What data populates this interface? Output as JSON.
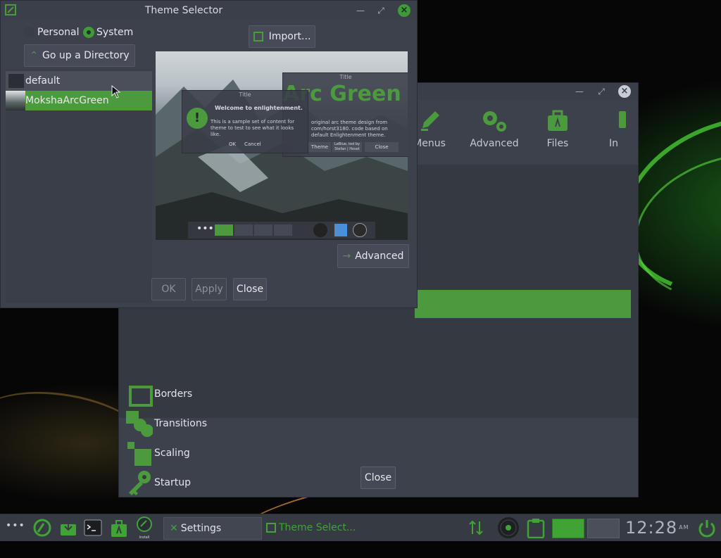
{
  "settings_window": {
    "icons": [
      {
        "label": "Menus"
      },
      {
        "label": "Advanced"
      },
      {
        "label": "Files"
      },
      {
        "label": "In"
      }
    ],
    "list": [
      {
        "label": "Borders"
      },
      {
        "label": "Transitions"
      },
      {
        "label": "Scaling"
      },
      {
        "label": "Startup"
      }
    ],
    "close_label": "Close"
  },
  "theme_window": {
    "title": "Theme Selector",
    "personal_label": "Personal",
    "system_label": "System",
    "go_up_label": "Go up a Directory",
    "import_label": "Import...",
    "files": [
      {
        "name": "default",
        "selected": false
      },
      {
        "name": "MokshaArcGreen",
        "selected": true
      }
    ],
    "advanced_label": "Advanced",
    "ok_label": "OK",
    "apply_label": "Apply",
    "close_label": "Close",
    "preview": {
      "big_title": "Arc Green",
      "dialog_title": "Title",
      "dialog_heading": "Welcome to enlightenment.",
      "dialog_text": "This is a sample set of content for theme to test to see what it looks like.",
      "dialog_ok": "OK",
      "dialog_cancel": "Cancel",
      "back_title": "Title",
      "back_text": "original arc theme design from com/horst3180. code based on default Enlightenment theme.",
      "back_btn_theme": "Theme",
      "back_btn_credit": "LeBlue, ted by Stefan | Hoset",
      "back_btn_close": "Close"
    }
  },
  "taskbar": {
    "settings_label": "Settings",
    "theme_label": "Theme Select...",
    "clock": "12:28",
    "ampm": "AM",
    "install_label": "Install"
  },
  "colors": {
    "accent": "#4c9a3e",
    "window_bg": "#3d414c",
    "list_bg": "#353942",
    "taskbar_bg": "#363a43"
  }
}
